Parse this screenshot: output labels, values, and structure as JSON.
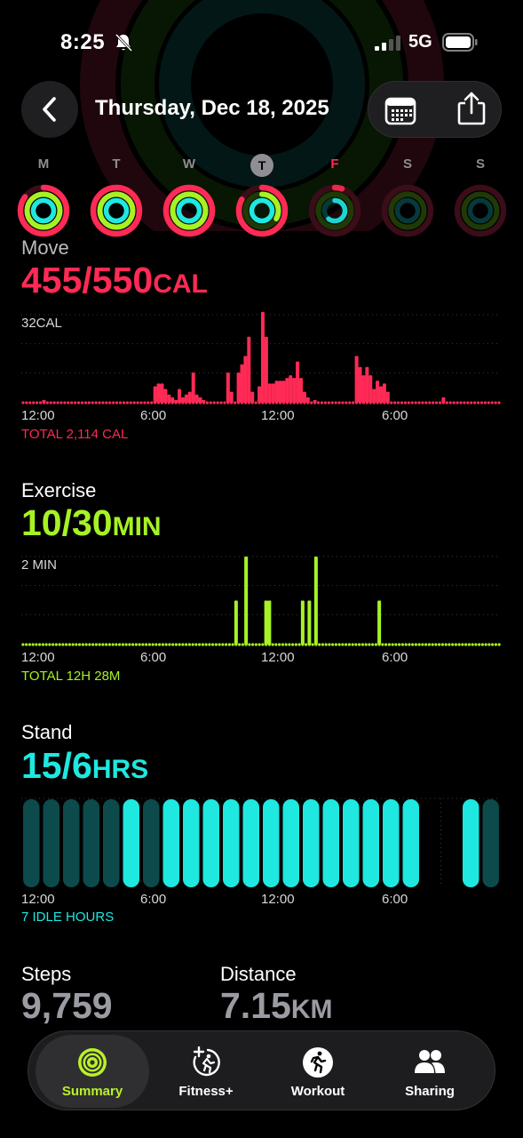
{
  "status": {
    "time": "8:25",
    "network": "5G"
  },
  "header": {
    "title": "Thursday, Dec 18, 2025"
  },
  "week": [
    {
      "letter": "M",
      "move": 0.85,
      "exercise": 1.0,
      "stand": 1.0,
      "state": "past"
    },
    {
      "letter": "T",
      "move": 1.0,
      "exercise": 1.0,
      "stand": 1.0,
      "state": "past"
    },
    {
      "letter": "W",
      "move": 1.0,
      "exercise": 1.0,
      "stand": 1.0,
      "state": "past"
    },
    {
      "letter": "T",
      "move": 0.83,
      "exercise": 0.33,
      "stand": 1.0,
      "state": "today"
    },
    {
      "letter": "F",
      "move": 0.05,
      "exercise": 0.0,
      "stand": 0.6,
      "state": "future-red"
    },
    {
      "letter": "S",
      "move": 0.0,
      "exercise": 0.0,
      "stand": 0.0,
      "state": "future"
    },
    {
      "letter": "S",
      "move": 0.0,
      "exercise": 0.0,
      "stand": 0.0,
      "state": "future"
    }
  ],
  "colors": {
    "move": "#ff2a55",
    "exercise": "#a6f224",
    "stand": "#1ee8e0",
    "stand_idle": "#0d4a4c"
  },
  "move": {
    "title": "Move",
    "value": "455/550",
    "unit": "CAL",
    "axis_top": "32CAL",
    "x_labels": [
      "12:00",
      "6:00",
      "12:00",
      "6:00"
    ],
    "total": "TOTAL 2,114 CAL"
  },
  "exercise": {
    "title": "Exercise",
    "value": "10/30",
    "unit": "MIN",
    "axis_top": "2 MIN",
    "x_labels": [
      "12:00",
      "6:00",
      "12:00",
      "6:00"
    ],
    "total": "TOTAL 12H 28M"
  },
  "stand": {
    "title": "Stand",
    "value": "15/6",
    "unit": "HRS",
    "x_labels": [
      "12:00",
      "6:00",
      "12:00",
      "6:00"
    ],
    "total": "7 IDLE HOURS"
  },
  "stats": {
    "steps_label": "Steps",
    "steps_value": "9,759",
    "distance_label": "Distance",
    "distance_value": "7.15",
    "distance_unit": "KM"
  },
  "tabs": [
    {
      "label": "Summary",
      "icon": "summary-rings-icon",
      "active": true
    },
    {
      "label": "Fitness+",
      "icon": "fitness-plus-icon",
      "active": false
    },
    {
      "label": "Workout",
      "icon": "workout-runner-icon",
      "active": false
    },
    {
      "label": "Sharing",
      "icon": "sharing-people-icon",
      "active": false
    }
  ],
  "chart_data": [
    {
      "type": "bar",
      "title": "Move",
      "ylabel": "32CAL",
      "x_tick_labels": [
        "12:00",
        "6:00",
        "12:00",
        "6:00"
      ],
      "ylim": [
        0,
        32
      ],
      "series": [
        {
          "values": [
            0,
            0,
            0,
            0,
            0,
            0,
            1,
            0,
            0,
            0,
            0,
            0,
            0,
            0,
            0,
            0,
            0,
            0,
            0,
            0,
            0,
            0,
            0,
            0,
            0,
            0,
            0,
            0,
            0,
            0,
            0,
            0,
            0,
            0,
            0,
            0,
            0,
            0,
            6,
            7,
            7,
            5,
            3,
            2,
            1,
            5,
            2,
            3,
            4,
            11,
            3,
            2,
            1,
            0,
            0,
            0,
            0,
            0,
            0,
            11,
            4,
            0,
            11,
            14,
            17,
            24,
            4,
            0,
            6,
            33,
            24,
            7,
            7,
            8,
            8,
            8,
            9,
            10,
            9,
            15,
            9,
            4,
            2,
            0,
            1,
            0,
            0,
            0,
            0,
            0,
            0,
            0,
            0,
            0,
            0,
            0,
            17,
            13,
            10,
            13,
            10,
            5,
            8,
            6,
            7,
            4,
            0,
            0,
            0,
            0,
            0,
            0,
            0,
            0,
            0,
            0,
            0,
            0,
            0,
            0,
            0,
            2,
            0,
            0,
            0,
            0,
            0,
            0,
            0,
            0,
            0,
            0,
            0,
            0,
            0,
            0,
            0,
            0
          ]
        }
      ]
    },
    {
      "type": "bar",
      "title": "Exercise",
      "ylabel": "2 MIN",
      "x_tick_labels": [
        "12:00",
        "6:00",
        "12:00",
        "6:00"
      ],
      "ylim": [
        0,
        2
      ],
      "series": [
        {
          "values": [
            0,
            0,
            0,
            0,
            0,
            0,
            0,
            0,
            0,
            0,
            0,
            0,
            0,
            0,
            0,
            0,
            0,
            0,
            0,
            0,
            0,
            0,
            0,
            0,
            0,
            0,
            0,
            0,
            0,
            0,
            0,
            0,
            0,
            0,
            0,
            0,
            0,
            0,
            0,
            0,
            0,
            0,
            0,
            0,
            0,
            0,
            0,
            0,
            0,
            0,
            0,
            0,
            0,
            0,
            0,
            0,
            0,
            0,
            0,
            0,
            0,
            0,
            0,
            0,
            1,
            0,
            0,
            2,
            0,
            0,
            0,
            0,
            0,
            1,
            1,
            0,
            0,
            0,
            0,
            0,
            0,
            0,
            0,
            0,
            1,
            0,
            1,
            0,
            2,
            0,
            0,
            0,
            0,
            0,
            0,
            0,
            0,
            0,
            0,
            0,
            0,
            0,
            0,
            0,
            0,
            0,
            0,
            1,
            0,
            0,
            0,
            0,
            0,
            0,
            0,
            0,
            0,
            0,
            0,
            0,
            0,
            0,
            0,
            0,
            0,
            0,
            0,
            0,
            0,
            0,
            0,
            0,
            0,
            0,
            0,
            0,
            0,
            0,
            0,
            0,
            0,
            0,
            0,
            0
          ]
        }
      ]
    },
    {
      "type": "bar",
      "title": "Stand",
      "x_tick_labels": [
        "12:00",
        "6:00",
        "12:00",
        "6:00"
      ],
      "hours": [
        0,
        1,
        2,
        3,
        4,
        5,
        6,
        7,
        8,
        9,
        10,
        11,
        12,
        13,
        14,
        15,
        16,
        17,
        18,
        19,
        20,
        21,
        22,
        23
      ],
      "stood": [
        0,
        0,
        0,
        0,
        0,
        1,
        0,
        1,
        1,
        1,
        1,
        1,
        1,
        1,
        1,
        1,
        1,
        1,
        1,
        1,
        null,
        null,
        1,
        0
      ]
    }
  ]
}
